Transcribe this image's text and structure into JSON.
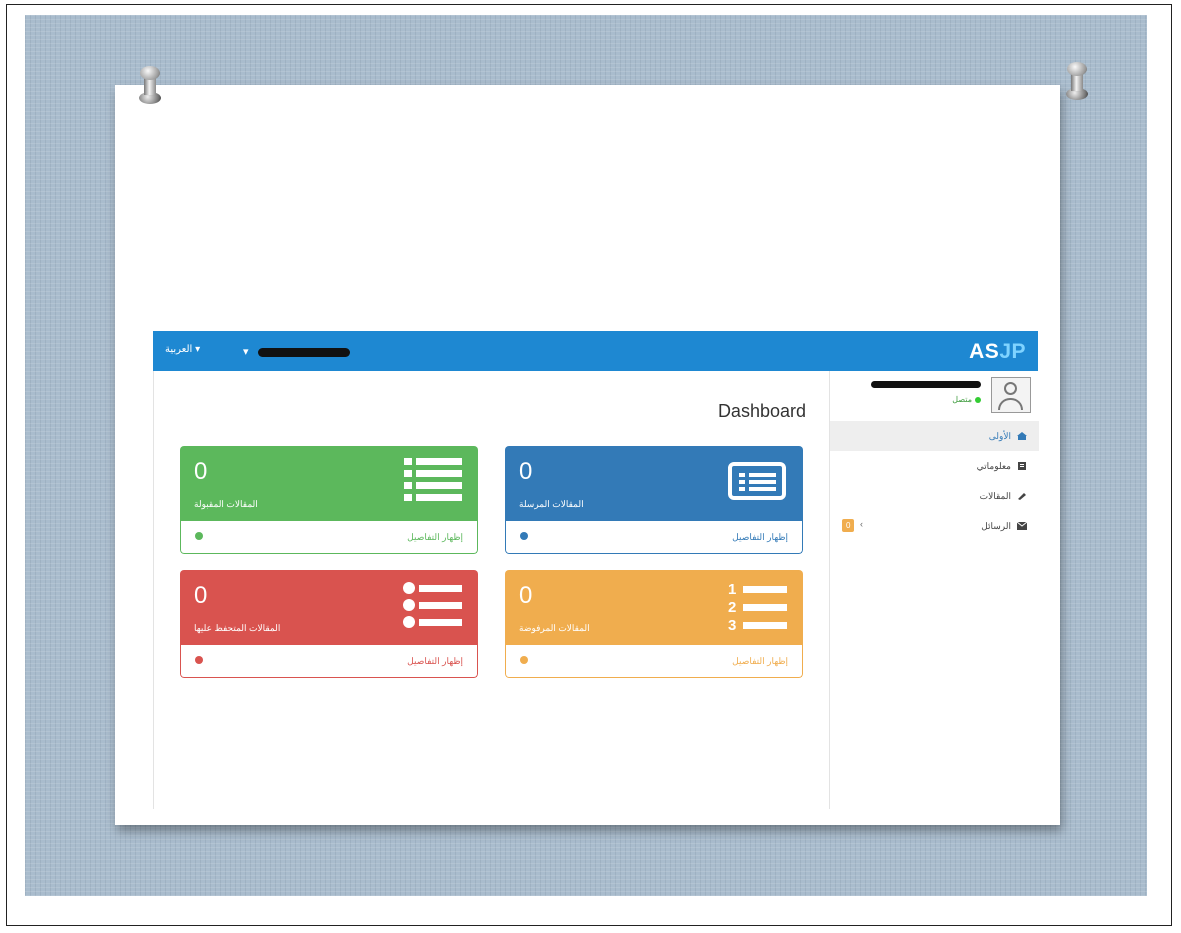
{
  "app": {
    "brand_prefix": "AS",
    "brand_suffix": "JP",
    "language": "العربية ▾",
    "user_menu_caret": "▾"
  },
  "page": {
    "title": "Dashboard"
  },
  "cards": [
    {
      "id": "sent",
      "value": "0",
      "label": "المقالات المرسلة",
      "details": "إظهار التفاصيل",
      "color": "#337ab7"
    },
    {
      "id": "accepted",
      "value": "0",
      "label": "المقالات المقبولة",
      "details": "إظهار التفاصيل",
      "color": "#5cb85c"
    },
    {
      "id": "rejected",
      "value": "0",
      "label": "المقالات المرفوضة",
      "details": "إظهار التفاصيل",
      "color": "#f0ad4e"
    },
    {
      "id": "pending",
      "value": "0",
      "label": "المقالات المتحفظ عليها",
      "details": "إظهار التفاصيل",
      "color": "#d9534f"
    }
  ],
  "sidebar": {
    "status": "متصل",
    "items": [
      {
        "label": "الأولى",
        "icon": "home-icon"
      },
      {
        "label": "معلوماتي",
        "icon": "profile-icon"
      },
      {
        "label": "المقالات",
        "icon": "article-icon"
      },
      {
        "label": "الرسائل",
        "icon": "envelope-icon",
        "badge": "0"
      }
    ]
  }
}
